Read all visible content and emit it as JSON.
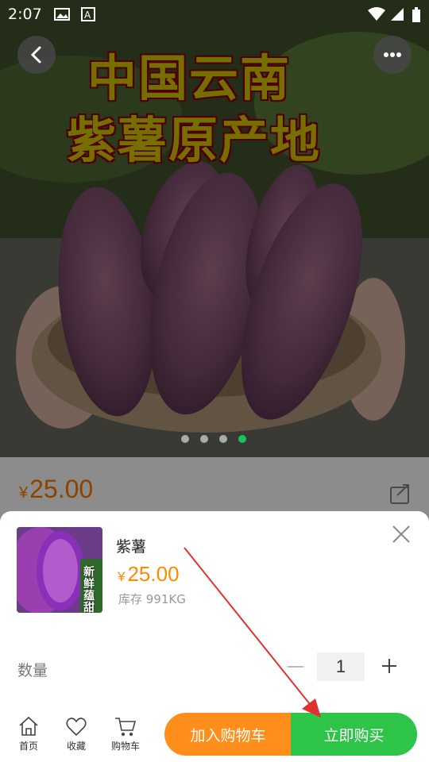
{
  "status_bar": {
    "time": "2:07",
    "icons": [
      "image-icon",
      "a-icon",
      "wifi-icon",
      "signal-icon",
      "battery-icon"
    ]
  },
  "hero": {
    "line1": "中国云南",
    "line2": "紫薯原产地",
    "carousel_count": 4,
    "carousel_active": 4
  },
  "product_price": {
    "currency": "¥",
    "amount": "25.00"
  },
  "sku_sheet": {
    "thumb_caption": "新鲜蕴甜",
    "name": "紫薯",
    "currency": "¥",
    "price": "25.00",
    "stock": "库存 991KG",
    "quantity_label": "数量",
    "quantity": "1"
  },
  "bottom_nav": [
    {
      "label": "首页",
      "icon": "home-icon"
    },
    {
      "label": "收藏",
      "icon": "heart-icon"
    },
    {
      "label": "购物车",
      "icon": "cart-icon"
    }
  ],
  "actions": {
    "add_to_cart": "加入购物车",
    "buy_now": "立即购买"
  },
  "colors": {
    "orange": "#ff8f1a",
    "green": "#2ec447",
    "price": "#ff7a00"
  }
}
